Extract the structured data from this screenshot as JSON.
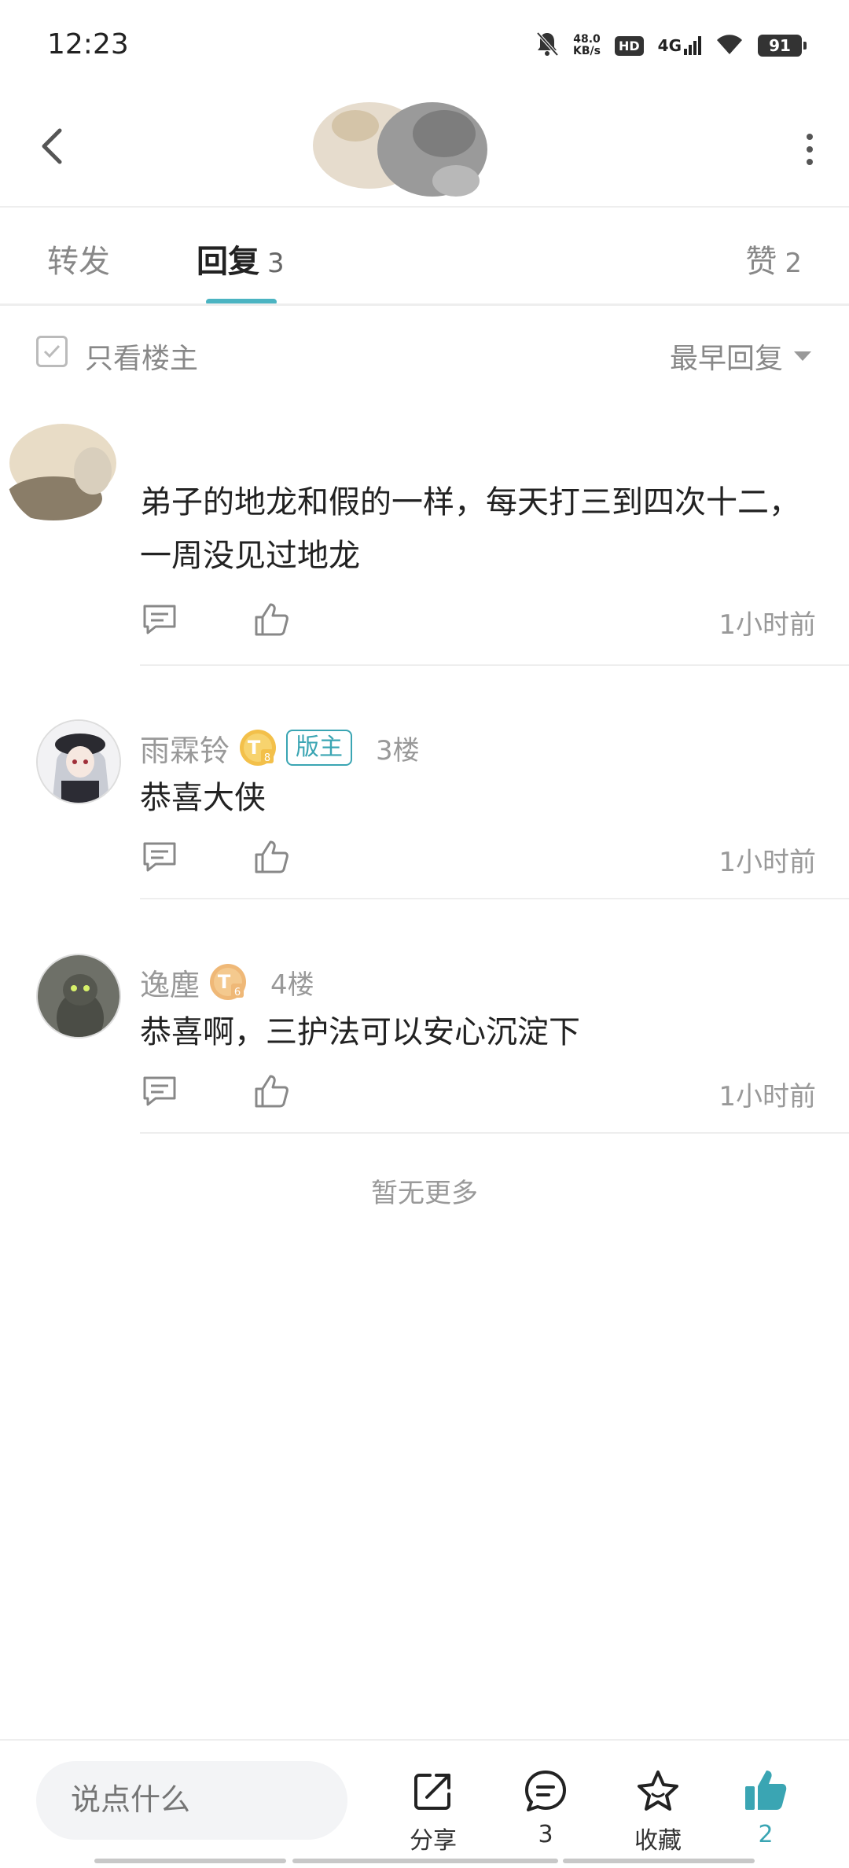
{
  "status_bar": {
    "time": "12:23",
    "net_speed_value": "48.0",
    "net_speed_unit": "KB/s",
    "hd_label": "HD",
    "network_label": "4G",
    "battery": "91",
    "icons": [
      "bell-off-icon",
      "signal-icon",
      "wifi-icon",
      "battery-icon"
    ]
  },
  "tabs": {
    "forward_label": "转发",
    "reply_label": "回复",
    "reply_count": "3",
    "like_label": "赞",
    "like_count": "2"
  },
  "filter": {
    "only_op_label": "只看楼主",
    "sort_label": "最早回复"
  },
  "replies": [
    {
      "username": "",
      "text": "弟子的地龙和假的一样，每天打三到四次十二，一周没见过地龙",
      "time": "1小时前"
    },
    {
      "username": "雨霖铃",
      "level": "8",
      "badge": "版主",
      "floor": "3楼",
      "text": "恭喜大侠",
      "time": "1小时前"
    },
    {
      "username": "逸塵",
      "level": "6",
      "floor": "4楼",
      "text": "恭喜啊，三护法可以安心沉淀下",
      "time": "1小时前"
    }
  ],
  "no_more_text": "暂无更多",
  "bottom_bar": {
    "input_placeholder": "说点什么",
    "share_label": "分享",
    "reply_count": "3",
    "favorite_label": "收藏",
    "like_count": "2"
  },
  "colors": {
    "accent": "#4bb4c2",
    "text_primary": "#222222",
    "text_secondary": "#999999",
    "divider": "#eeeeee"
  }
}
